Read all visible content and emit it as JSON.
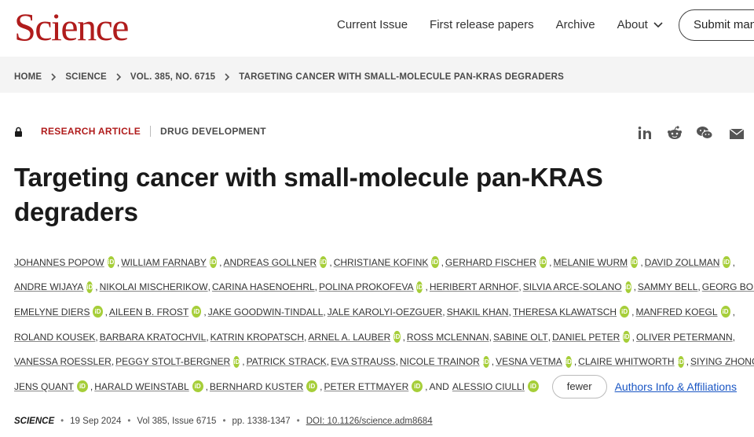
{
  "header": {
    "logo": "Science",
    "nav": [
      "Current Issue",
      "First release papers",
      "Archive",
      "About"
    ],
    "submit_label": "Submit man"
  },
  "breadcrumb": [
    "HOME",
    "SCIENCE",
    "VOL. 385, NO. 6715",
    "TARGETING CANCER WITH SMALL-MOLECULE PAN-KRAS DEGRADERS"
  ],
  "article": {
    "type": "RESEARCH ARTICLE",
    "subject": "DRUG DEVELOPMENT",
    "title": "Targeting cancer with small-molecule pan-KRAS degraders",
    "share_icons": [
      "linkedin-icon",
      "reddit-icon",
      "wechat-icon",
      "email-icon"
    ]
  },
  "authors": [
    {
      "name": "JOHANNES POPOW",
      "orcid": true
    },
    {
      "name": "WILLIAM FARNABY",
      "orcid": true
    },
    {
      "name": "ANDREAS GOLLNER",
      "orcid": true
    },
    {
      "name": "CHRISTIANE KOFINK",
      "orcid": true
    },
    {
      "name": "GERHARD FISCHER",
      "orcid": true
    },
    {
      "name": "MELANIE WURM",
      "orcid": true
    },
    {
      "name": "DAVID ZOLLMAN",
      "orcid": true
    },
    {
      "name": "ANDRE WIJAYA",
      "orcid": true
    },
    {
      "name": "NIKOLAI MISCHERIKOW",
      "orcid": false
    },
    {
      "name": "CARINA HASENOEHRL",
      "orcid": false
    },
    {
      "name": "POLINA PROKOFEVA",
      "orcid": true
    },
    {
      "name": "HERIBERT ARNHOF",
      "orcid": false
    },
    {
      "name": "SILVIA ARCE-SOLANO",
      "orcid": true
    },
    {
      "name": "SAMMY BELL",
      "orcid": false
    },
    {
      "name": "GEORG BOECK",
      "orcid": true
    },
    {
      "name": "EMELYNE DIERS",
      "orcid": true
    },
    {
      "name": "AILEEN B. FROST",
      "orcid": true
    },
    {
      "name": "JAKE GOODWIN-TINDALL",
      "orcid": false
    },
    {
      "name": "JALE KAROLYI-OEZGUER",
      "orcid": false
    },
    {
      "name": "SHAKIL KHAN",
      "orcid": false
    },
    {
      "name": "THERESA KLAWATSCH",
      "orcid": true
    },
    {
      "name": "MANFRED KOEGL",
      "orcid": true
    },
    {
      "name": "ROLAND KOUSEK",
      "orcid": false
    },
    {
      "name": "BARBARA KRATOCHVIL",
      "orcid": false
    },
    {
      "name": "KATRIN KROPATSCH",
      "orcid": false
    },
    {
      "name": "ARNEL A. LAUBER",
      "orcid": true
    },
    {
      "name": "ROSS MCLENNAN",
      "orcid": false
    },
    {
      "name": "SABINE OLT",
      "orcid": false
    },
    {
      "name": "DANIEL PETER",
      "orcid": true
    },
    {
      "name": "OLIVER PETERMANN",
      "orcid": false
    },
    {
      "name": "VANESSA ROESSLER",
      "orcid": false
    },
    {
      "name": "PEGGY STOLT-BERGNER",
      "orcid": true
    },
    {
      "name": "PATRICK STRACK",
      "orcid": false
    },
    {
      "name": "EVA STRAUSS",
      "orcid": false
    },
    {
      "name": "NICOLE TRAINOR",
      "orcid": true
    },
    {
      "name": "VESNA VETMA",
      "orcid": true
    },
    {
      "name": "CLAIRE WHITWORTH",
      "orcid": true
    },
    {
      "name": "SIYING ZHONG",
      "orcid": false
    },
    {
      "name": "JENS QUANT",
      "orcid": true
    },
    {
      "name": "HARALD WEINSTABL",
      "orcid": true
    },
    {
      "name": "BERNHARD KUSTER",
      "orcid": true
    },
    {
      "name": "PETER ETTMAYER",
      "orcid": true
    },
    {
      "name": "ALESSIO CIULLI",
      "orcid": true
    }
  ],
  "author_breaks_after": [
    6,
    14,
    21,
    29,
    37
  ],
  "author_controls": {
    "and_text": "AND",
    "orcid_glyph": "iD",
    "fewer_label": "fewer",
    "affiliations_label": "Authors Info & Affiliations"
  },
  "citation": {
    "journal": "SCIENCE",
    "date": "19 Sep 2024",
    "volume": "Vol 385, Issue 6715",
    "pages": "pp. 1338-1347",
    "doi": "DOI: 10.1126/science.adm8684"
  },
  "colors": {
    "brand_red": "#b01c1c",
    "orcid_green": "#a6ce39",
    "link_blue": "#1a56c4"
  }
}
